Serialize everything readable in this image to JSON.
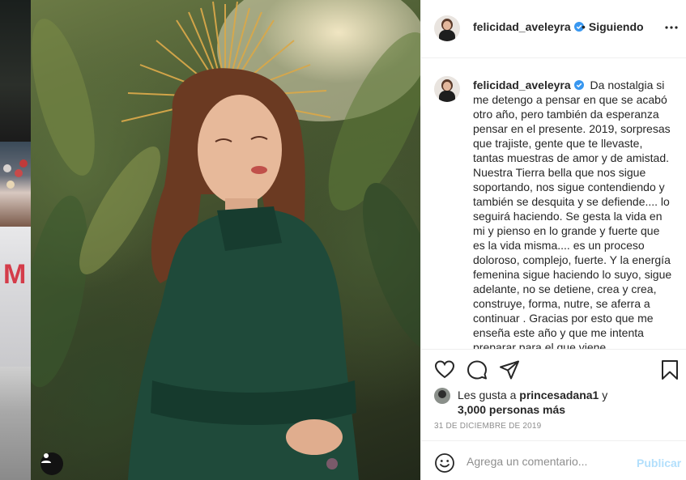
{
  "post": {
    "username": "felicidad_aveleyra",
    "follow_status": "Siguiendo",
    "follow_dot": "•",
    "verified": true,
    "more_icon": "more-horizontal-icon",
    "caption_username": "felicidad_aveleyra",
    "caption": "Da nostalgia si me detengo a pensar en que se acabó otro año, pero también da esperanza pensar en el presente. 2019, sorpresas que trajiste, gente que te llevaste, tantas muestras de amor y de amistad. Nuestra Tierra bella que nos sigue soportando, nos sigue contendiendo y también se desquita y se defiende.... lo seguirá haciendo. Se gesta la vida en mi y pienso en lo grande y fuerte que es la vida misma.... es un proceso doloroso, complejo, fuerte. Y la energía femenina sigue haciendo lo suyo, sigue adelante, no se detiene, crea y crea, construye, forma, nutre, se aferra a continuar . Gracias por esto que me enseña este año y que me intenta preparar para el que viene."
  },
  "actions": {
    "like_icon": "heart-icon",
    "comment_icon": "comment-icon",
    "share_icon": "send-icon",
    "save_icon": "bookmark-icon"
  },
  "likes": {
    "prefix": "Les gusta a",
    "liker": "princesadana1",
    "conj": "y",
    "others": "3,000 personas más"
  },
  "date": "31 DE DICIEMBRE DE 2019",
  "comment": {
    "placeholder": "Agrega un comentario...",
    "post_label": "Publicar",
    "emoji_icon": "emoji-icon"
  },
  "colors": {
    "verified": "#3897f0",
    "publish_disabled": "#b2dffc",
    "muted": "#8e8e8e",
    "text": "#262626"
  }
}
